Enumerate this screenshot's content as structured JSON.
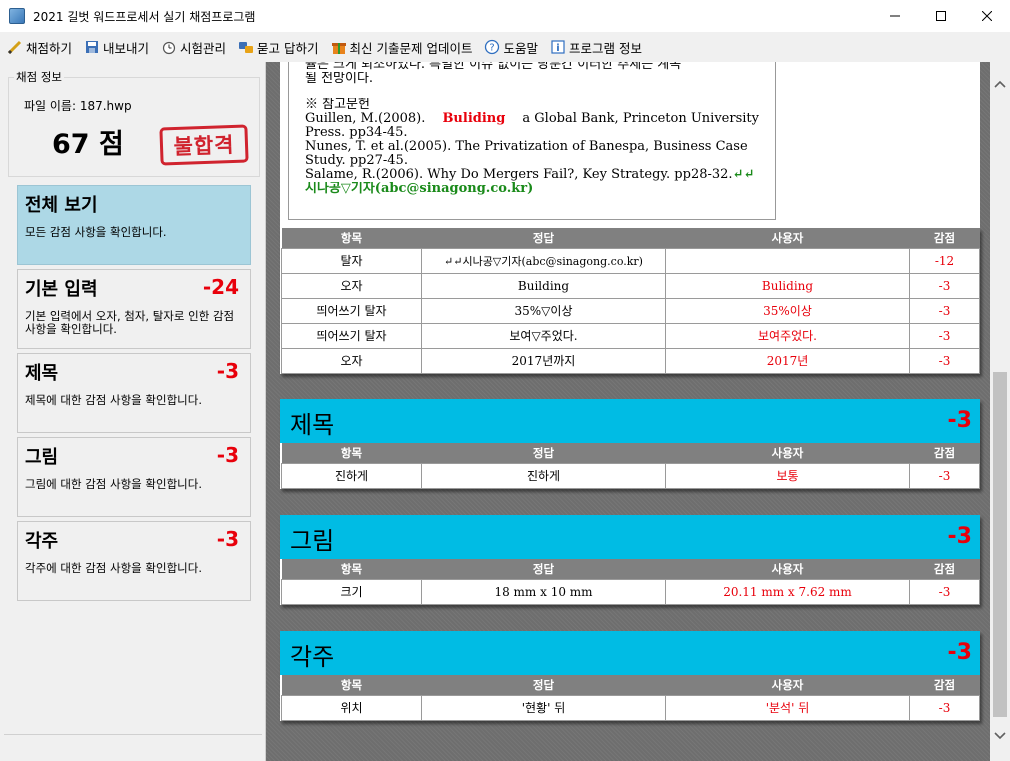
{
  "window": {
    "title": "2021 길벗 워드프로세서 실기 채점프로그램"
  },
  "menu": [
    {
      "label": "채점하기",
      "icon": "pencil-icon"
    },
    {
      "label": "내보내기",
      "icon": "save-icon"
    },
    {
      "label": "시험관리",
      "icon": "clock-icon"
    },
    {
      "label": "묻고 답하기",
      "icon": "qa-icon"
    },
    {
      "label": "최신 기출문제 업데이트",
      "icon": "gift-icon"
    },
    {
      "label": "도움말",
      "icon": "help-icon"
    },
    {
      "label": "프로그램 정보",
      "icon": "info-icon"
    }
  ],
  "info": {
    "legend": "채점 정보",
    "filename": "파일 이름: 187.hwp",
    "score": "67 점",
    "result": "불합격"
  },
  "categories": [
    {
      "title": "전체 보기",
      "score": "",
      "desc": "모든 감점 사항을 확인합니다."
    },
    {
      "title": "기본 입력",
      "score": "-24",
      "desc": "기본 입력에서 오자, 첨자, 탈자로 인한 감점 사항을 확인합니다."
    },
    {
      "title": "제목",
      "score": "-3",
      "desc": "제목에 대한 감점 사항을 확인합니다."
    },
    {
      "title": "그림",
      "score": "-3",
      "desc": "그림에 대한 감점 사항을 확인합니다."
    },
    {
      "title": "각주",
      "score": "-3",
      "desc": "각주에 대한 감점 사항을 확인합니다."
    }
  ],
  "document": {
    "line1": "률은 크게 퇴조하였다. 특별한 이슈 없이는 당분간 이러한 추세는 계속",
    "line2": "될 전망이다.",
    "ref_header": "※ 참고문헌",
    "ref1_a": "Guillen, M.(2008).",
    "ref1_red": "Buliding",
    "ref1_b": "a Global Bank, Princeton University",
    "ref1_c": "Press. pp34-45.",
    "ref2_a": "Nunes, T. et al.(2005). The Privatization of Banespa, Business Case",
    "ref2_b": "Study. pp27-45.",
    "ref3": "Salame, R.(2006). Why Do Mergers Fail?, Key Strategy. pp28-32.",
    "ref3_marks": "↵↵",
    "footer": "시나공▽기자(abc@sinagong.co.kr)"
  },
  "table_headers": {
    "item": "항목",
    "answer": "정답",
    "user": "사용자",
    "deduct": "감점"
  },
  "basic_rows": [
    {
      "item": "탈자",
      "answer": "↵↵시나공▽기자(abc@sinagong.co.kr)",
      "user": "",
      "deduct": "-12"
    },
    {
      "item": "오자",
      "answer": "Building",
      "user": "Buliding",
      "deduct": "-3"
    },
    {
      "item": "띄어쓰기 탈자",
      "answer": "35%▽이상",
      "user": "35%이상",
      "deduct": "-3"
    },
    {
      "item": "띄어쓰기 탈자",
      "answer": "보여▽주었다.",
      "user": "보여주었다.",
      "deduct": "-3"
    },
    {
      "item": "오자",
      "answer": "2017년까지",
      "user": "2017년",
      "deduct": "-3"
    }
  ],
  "sections": [
    {
      "title": "제목",
      "score": "-3",
      "rows": [
        {
          "item": "진하게",
          "answer": "진하게",
          "user": "보통",
          "deduct": "-3"
        }
      ]
    },
    {
      "title": "그림",
      "score": "-3",
      "rows": [
        {
          "item": "크기",
          "answer": "18 mm x 10 mm",
          "user": "20.11 mm x 7.62 mm",
          "deduct": "-3"
        }
      ]
    },
    {
      "title": "각주",
      "score": "-3",
      "rows": [
        {
          "item": "위치",
          "answer": "'현황' 뒤",
          "user": "'분석' 뒤",
          "deduct": "-3"
        }
      ]
    }
  ],
  "colors": {
    "section_header": "#00bce4",
    "deduction_red": "#e8000b",
    "active_category": "#add8e6",
    "table_header": "#808080"
  }
}
